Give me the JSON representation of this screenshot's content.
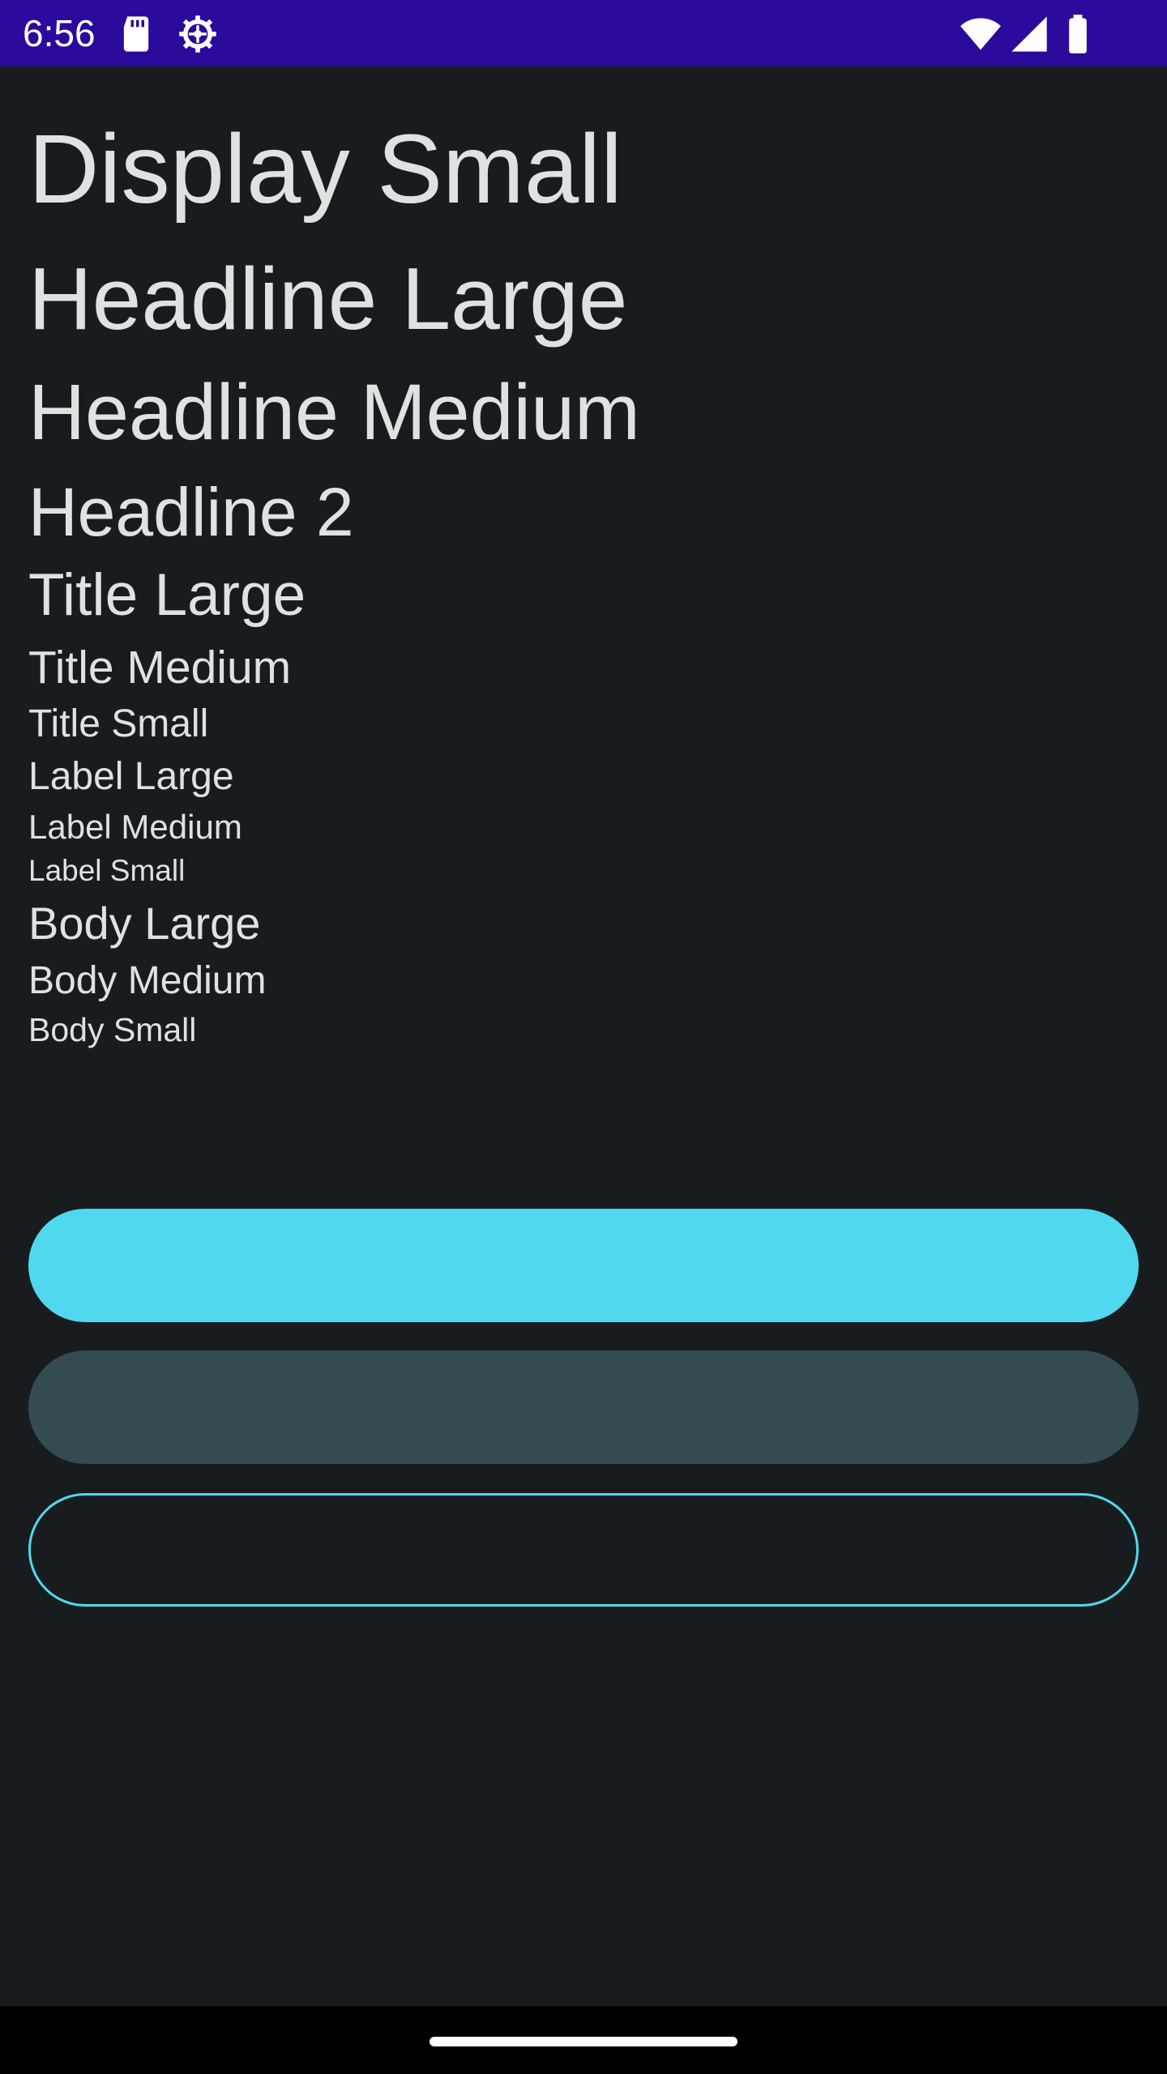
{
  "status_bar": {
    "time": "6:56",
    "icons": [
      "sd-card-icon",
      "settings-gear-icon",
      "wifi-icon",
      "cell-signal-icon",
      "battery-icon"
    ],
    "background": "#2a0b9b"
  },
  "typography": {
    "display_small": "Display Small",
    "headline_large": "Headline Large",
    "headline_medium": "Headline Medium",
    "headline_2": "Headline 2",
    "title_large": "Title Large",
    "title_medium": "Title Medium",
    "title_small": "Title Small",
    "label_large": "Label Large",
    "label_medium": "Label Medium",
    "label_small": "Label Small",
    "body_large": "Body Large",
    "body_medium": "Body Medium",
    "body_small": "Body Small"
  },
  "buttons": {
    "filled_label": "",
    "tonal_label": "",
    "outlined_label": ""
  },
  "colors": {
    "background": "#191c1e",
    "primary": "#50d8ef",
    "secondary_container": "#334b51",
    "on_surface": "#e1e3e4"
  }
}
